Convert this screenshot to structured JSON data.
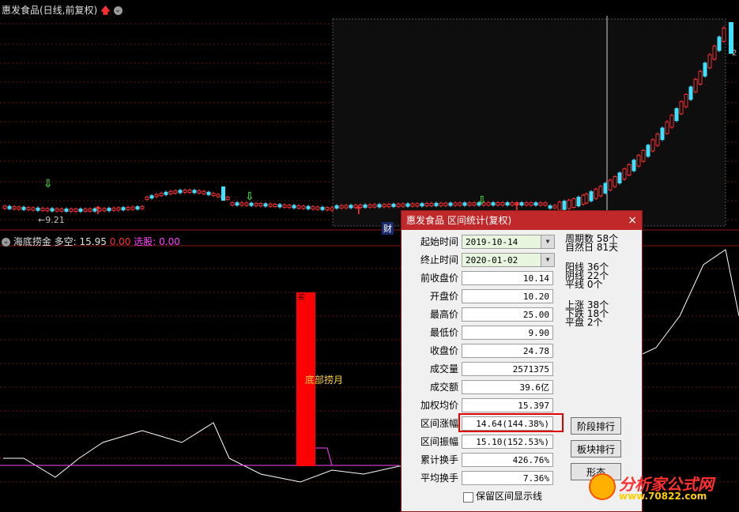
{
  "chart": {
    "title": "惠发食品(日线,前复权)",
    "low_label": "←9.21",
    "right_price": "2",
    "marker_cai": "财"
  },
  "indicator": {
    "name": "海底捞金",
    "mode_label": "多空:",
    "mode_value": "15.95",
    "zero_value": "0.00",
    "pick_label": "选股:",
    "pick_value": "0.00",
    "bar_label": "底部捞月",
    "bar_top": "买"
  },
  "dialog": {
    "title": "惠发食品 区间统计(复权)",
    "close": "×",
    "fields": [
      {
        "label": "起始时间",
        "value": "2019-10-14"
      },
      {
        "label": "终止时间",
        "value": "2020-01-02"
      },
      {
        "label": "前收盘价",
        "value": "10.14"
      },
      {
        "label": "开盘价",
        "value": "10.20"
      },
      {
        "label": "最高价",
        "value": "25.00"
      },
      {
        "label": "最低价",
        "value": "9.90"
      },
      {
        "label": "收盘价",
        "value": "24.78"
      },
      {
        "label": "成交量",
        "value": "2571375"
      },
      {
        "label": "成交额",
        "value": "39.6亿"
      },
      {
        "label": "加权均价",
        "value": "15.397"
      },
      {
        "label": "区间涨幅",
        "value": "14.64(144.38%)"
      },
      {
        "label": "区间振幅",
        "value": "15.10(152.53%)"
      },
      {
        "label": "累计换手",
        "value": "426.76%"
      },
      {
        "label": "平均换手",
        "value": "7.36%"
      }
    ],
    "stats": {
      "period_count": "周期数 58个",
      "natural_days": "自然日 81天",
      "yang": "阳线 36个",
      "yin": "阴线 22个",
      "flat": "平线 0个",
      "up": "上涨 38个",
      "down": "下跌 18个",
      "level": "平盘 2个"
    },
    "buttons": {
      "stage_rank": "阶段排行",
      "sector_rank": "板块排行",
      "third": "形态"
    },
    "checkbox_label": "保留区间显示线"
  },
  "watermark": {
    "line1": "分析家公式网",
    "line2": "www.70822.com"
  },
  "colors": {
    "up": "#ff3030",
    "down": "#40e0ff",
    "grid": "#7a1a1a",
    "dialog_title": "#c0282a"
  }
}
